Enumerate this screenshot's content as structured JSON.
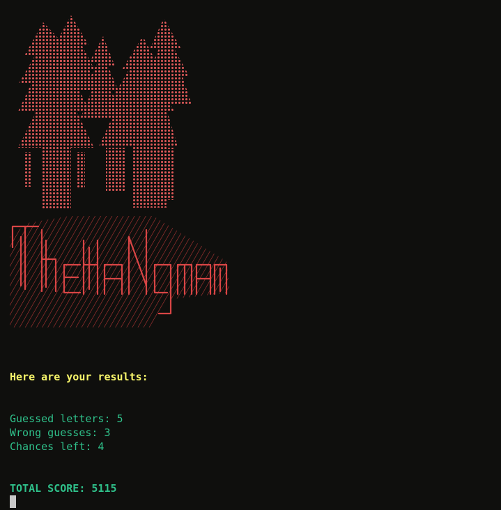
{
  "colors": {
    "background": "#0f0f0d",
    "art_red": "#e05a5a",
    "heading_yellow": "#f6f46a",
    "stats_green": "#2fc08a"
  },
  "icons": [
    "forest-trees-ascii-art",
    "hangman-title-ascii-art",
    "terminal-cursor"
  ],
  "results": {
    "heading": "Here are your results:",
    "guessed": "Guessed letters: 5",
    "wrong": "Wrong guesses: 3",
    "chances": "Chances left: 4",
    "total": "TOTAL SCORE: 5115"
  }
}
